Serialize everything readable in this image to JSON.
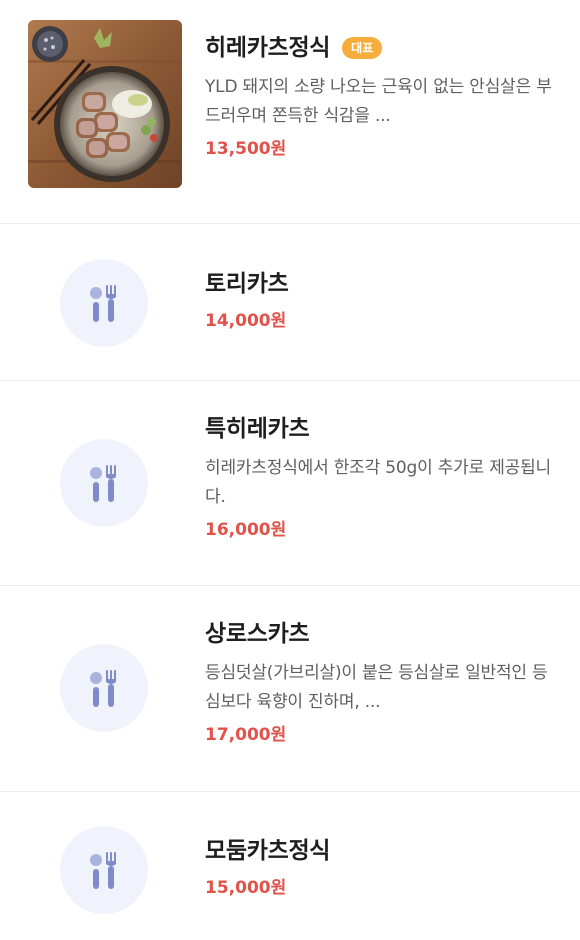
{
  "menu": {
    "items": [
      {
        "name": "히레카츠정식",
        "badge": "대표",
        "description": "YLD 돼지의 소량 나오는 근육이 없는 안심살은 부드러우며 쫀득한 식감을 ...",
        "price": "13,500원",
        "image": "tonkatsu-plate-photo"
      },
      {
        "name": "토리카츠",
        "price": "14,000원",
        "image": "utensils-icon"
      },
      {
        "name": "특히레카츠",
        "description": "히레카츠정식에서 한조각 50g이 추가로 제공됩니다.",
        "price": "16,000원",
        "image": "utensils-icon"
      },
      {
        "name": "상로스카츠",
        "description": "등심덧살(가브리살)이 붙은 등심살로 일반적인 등심보다 육향이 진하며, ...",
        "price": "17,000원",
        "image": "utensils-icon"
      },
      {
        "name": "모둠카츠정식",
        "price": "15,000원",
        "image": "utensils-icon"
      }
    ]
  },
  "colors": {
    "price": "#e0524a",
    "badge": "#f7ad3c",
    "placeholder_bg": "#f0f3fb",
    "icon": "#97a4db"
  }
}
